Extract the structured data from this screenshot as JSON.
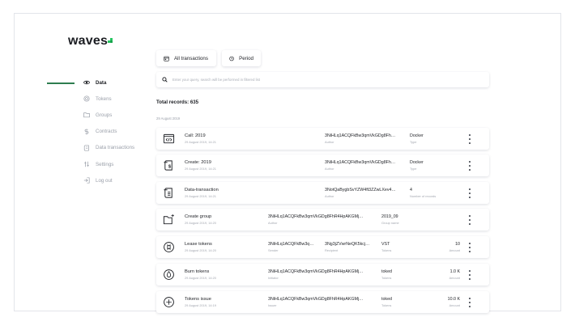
{
  "sidebar": {
    "logo": "waves",
    "brand_color": "#22c55e",
    "items": [
      {
        "label": "Data",
        "icon": "eye-icon",
        "active": true
      },
      {
        "label": "Tokens",
        "icon": "token-icon"
      },
      {
        "label": "Groups",
        "icon": "folder-icon"
      },
      {
        "label": "Contracts",
        "icon": "contract-icon"
      },
      {
        "label": "Data transactions",
        "icon": "data-transaction-icon"
      },
      {
        "label": "Settings",
        "icon": "settings-icon"
      },
      {
        "label": "Log out",
        "icon": "logout-icon"
      }
    ]
  },
  "toolbar": {
    "all_transactions": "All transactions",
    "period": "Period"
  },
  "search": {
    "placeholder": "Enter your query, search will be performed in filtered list"
  },
  "summary": {
    "total": "Total records: 635",
    "date_group": "29 August 2019"
  },
  "rows": [
    {
      "icon": "code-icon",
      "title": "Call: 2019",
      "date": "29 August 2019, 14:21",
      "col1": {
        "value": "3NiHLq1ACQFkBw3qmVkGDg8Fh…",
        "label": "Author"
      },
      "col2": {
        "value": "Docker",
        "label": "Type"
      }
    },
    {
      "icon": "create-icon",
      "title": "Create: 2019",
      "date": "29 August 2019, 14:21",
      "col1": {
        "value": "3NiHLq1ACQFkBw3qmVkGDg8Fh…",
        "label": "Author"
      },
      "col2": {
        "value": "Docker",
        "label": "Type"
      }
    },
    {
      "icon": "data-transaction-icon",
      "title": "Data-transaction",
      "date": "29 August 2019, 14:21",
      "col1": {
        "value": "3NotQaBygbSvYZW4ft3ZZwLXev4…",
        "label": "Author"
      },
      "col2": {
        "value": "4",
        "label": "Number of records"
      }
    },
    {
      "icon": "folder-plus-icon",
      "title": "Create group",
      "date": "29 August 2019, 14:20",
      "col1": {
        "value": "3NiHLq1ACQFkBw3qmVkGDg8FhR4HpAKGMj…",
        "label": "Author"
      },
      "col2": {
        "value": "2019_09",
        "label": "Group name"
      }
    },
    {
      "icon": "lease-icon",
      "title": "Lease tokens",
      "date": "29 August 2019, 14:20",
      "col1": {
        "value": "3NiHLq1ACQFkBw3q…",
        "label": "Sender"
      },
      "col1b": {
        "value": "3Ng3jZVwrNeQK5kcj…",
        "label": "Recipient"
      },
      "col2": {
        "value": "VST",
        "label": "Tokens"
      },
      "col3": {
        "value": "10",
        "label": "Amount"
      }
    },
    {
      "icon": "burn-icon",
      "title": "Burn tokens",
      "date": "29 August 2019, 14:20",
      "col1": {
        "value": "3NiHLq1ACQFkBw3qmVkGDg8FhR4HpAKGMj…",
        "label": "Initiator"
      },
      "col2": {
        "value": "toked",
        "label": "Tokens"
      },
      "col3": {
        "value": "1.0 K",
        "label": "Amount"
      }
    },
    {
      "icon": "plus-circle-icon",
      "title": "Tokens issue",
      "date": "29 August 2019, 14:19",
      "col1": {
        "value": "3NiHLq1ACQFkBw3qmVkGDg8FhR4HpAKGMj…",
        "label": "Issuer"
      },
      "col2": {
        "value": "toked",
        "label": "Tokens"
      },
      "col3": {
        "value": "10.0 K",
        "label": "Amount"
      }
    }
  ]
}
